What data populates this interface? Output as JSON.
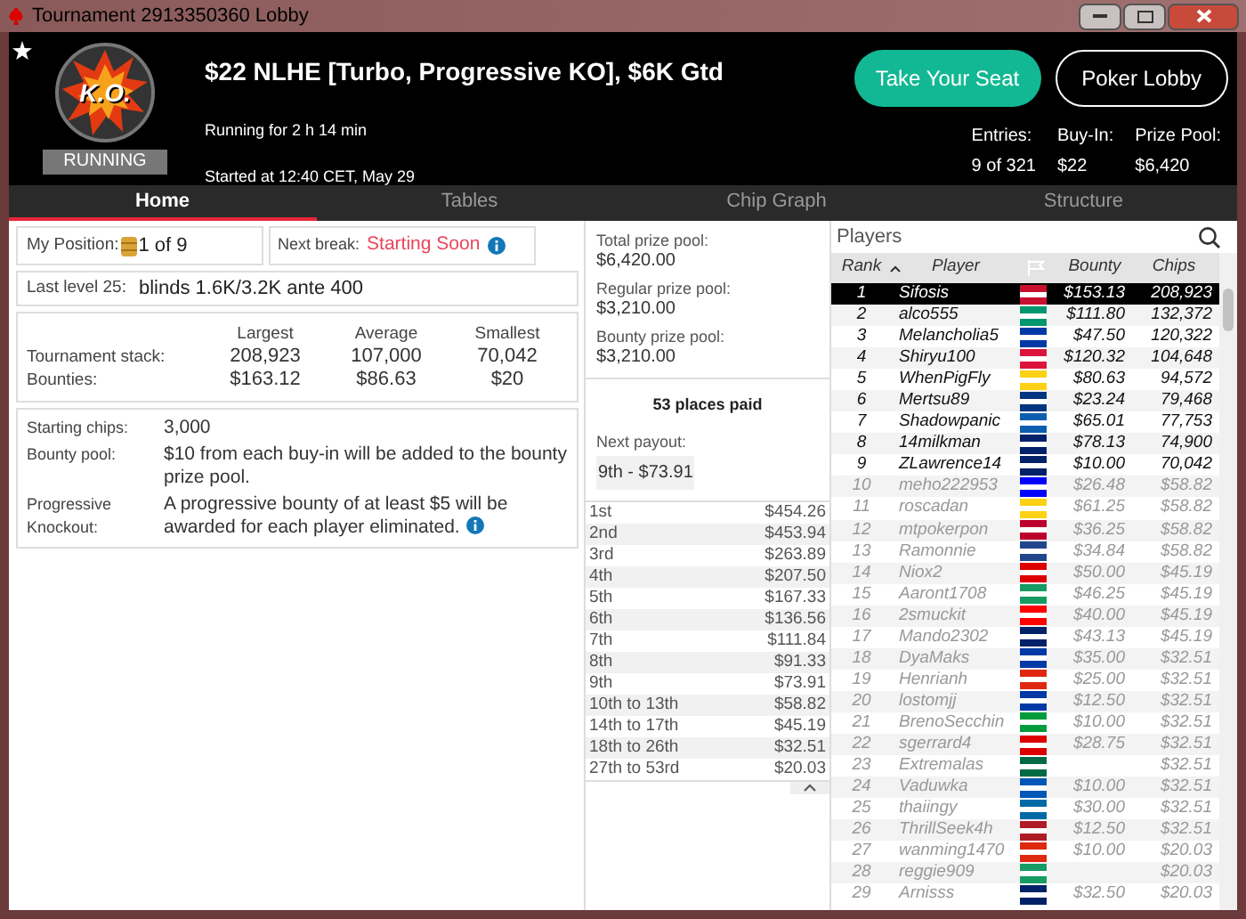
{
  "window": {
    "title": "Tournament 2913350360 Lobby"
  },
  "header": {
    "logo_text": "K.O.",
    "status": "RUNNING",
    "title": "$22 NLHE [Turbo, Progressive KO], $6K Gtd",
    "running_for": "Running for 2 h 14 min",
    "started": "Started at 12:40 CET, May 29",
    "favorite": false,
    "buttons": [
      {
        "label": "Take Your Seat",
        "kind": "primary"
      },
      {
        "label": "Poker Lobby",
        "kind": "outline"
      }
    ],
    "stats": [
      {
        "label": "Entries:",
        "value": "9 of 321"
      },
      {
        "label": "Buy-In:",
        "value": "$22"
      },
      {
        "label": "Prize Pool:",
        "value": "$6,420"
      }
    ]
  },
  "tabs": [
    {
      "label": "Home",
      "selected": true
    },
    {
      "label": "Tables",
      "selected": false
    },
    {
      "label": "Chip Graph",
      "selected": false
    },
    {
      "label": "Structure",
      "selected": false
    }
  ],
  "home": {
    "position_label": "My Position:",
    "position": "1 of 9",
    "break_label": "Next break:",
    "break_value": "Starting Soon",
    "last_level_label": "Last level 25:",
    "last_level": "blinds 1.6K/3.2K ante 400",
    "stack_table": {
      "columns": [
        "Largest",
        "Average",
        "Smallest"
      ],
      "rows": [
        {
          "label": "Tournament stack:",
          "values": [
            "208,923",
            "107,000",
            "70,042"
          ]
        },
        {
          "label": "Bounties:",
          "values": [
            "$163.12",
            "$86.63",
            "$20"
          ]
        }
      ]
    },
    "info": [
      {
        "label": "Starting chips:",
        "text": "3,000",
        "info_icon": false
      },
      {
        "label": "Bounty pool:",
        "text": "$10 from each buy-in will be added to the bounty prize pool.",
        "info_icon": false
      },
      {
        "label": "Progressive Knockout:",
        "text": "A progressive bounty of at least $5 will be awarded for each player eliminated.",
        "info_icon": true
      }
    ]
  },
  "prizes": {
    "pools": [
      {
        "label": "Total prize pool:",
        "value": "$6,420.00"
      },
      {
        "label": "Regular prize pool:",
        "value": "$3,210.00"
      },
      {
        "label": "Bounty prize pool:",
        "value": "$3,210.00"
      }
    ],
    "places_paid": "53 places paid",
    "next_payout_label": "Next payout:",
    "next_payout": "9th - $73.91",
    "payouts": [
      [
        "1st",
        "$454.26"
      ],
      [
        "2nd",
        "$453.94"
      ],
      [
        "3rd",
        "$263.89"
      ],
      [
        "4th",
        "$207.50"
      ],
      [
        "5th",
        "$167.33"
      ],
      [
        "6th",
        "$136.56"
      ],
      [
        "7th",
        "$111.84"
      ],
      [
        "8th",
        "$91.33"
      ],
      [
        "9th",
        "$73.91"
      ],
      [
        "10th to 13th",
        "$58.82"
      ],
      [
        "14th to 17th",
        "$45.19"
      ],
      [
        "18th to 26th",
        "$32.51"
      ],
      [
        "27th to 53rd",
        "$20.03"
      ]
    ]
  },
  "players": {
    "title": "Players",
    "columns": [
      "Rank",
      "Player",
      "Bounty",
      "Chips"
    ],
    "rows": [
      {
        "rank": "1",
        "name": "Sifosis",
        "bounty": "$153.13",
        "chips": "208,923",
        "selected": true,
        "greyed": false,
        "color": "#c8102e"
      },
      {
        "rank": "2",
        "name": "alco555",
        "bounty": "$111.80",
        "chips": "132,372",
        "selected": false,
        "greyed": false,
        "color": "#00966e"
      },
      {
        "rank": "3",
        "name": "Melancholia5",
        "bounty": "$47.50",
        "chips": "120,322",
        "selected": false,
        "greyed": false,
        "color": "#0039a6"
      },
      {
        "rank": "4",
        "name": "Shiryu100",
        "bounty": "$120.32",
        "chips": "104,648",
        "selected": false,
        "greyed": false,
        "color": "#dc143c"
      },
      {
        "rank": "5",
        "name": "WhenPigFly",
        "bounty": "$80.63",
        "chips": "94,572",
        "selected": false,
        "greyed": false,
        "color": "#fcd116"
      },
      {
        "rank": "6",
        "name": "Mertsu89",
        "bounty": "$23.24",
        "chips": "79,468",
        "selected": false,
        "greyed": false,
        "color": "#003580"
      },
      {
        "rank": "7",
        "name": "Shadowpanic",
        "bounty": "$65.01",
        "chips": "77,753",
        "selected": false,
        "greyed": false,
        "color": "#0d5eaf"
      },
      {
        "rank": "8",
        "name": "14milkman",
        "bounty": "$78.13",
        "chips": "74,900",
        "selected": false,
        "greyed": false,
        "color": "#012169"
      },
      {
        "rank": "9",
        "name": "ZLawrence14",
        "bounty": "$10.00",
        "chips": "70,042",
        "selected": false,
        "greyed": false,
        "color": "#012169"
      },
      {
        "rank": "10",
        "name": "meho222953",
        "bounty": "$26.48",
        "chips": "$58.82",
        "selected": false,
        "greyed": true,
        "color": "#0000ff"
      },
      {
        "rank": "11",
        "name": "roscadan",
        "bounty": "$61.25",
        "chips": "$58.82",
        "selected": false,
        "greyed": true,
        "color": "#fcd116"
      },
      {
        "rank": "12",
        "name": "mtpokerpon",
        "bounty": "$36.25",
        "chips": "$58.82",
        "selected": false,
        "greyed": true,
        "color": "#bc002d"
      },
      {
        "rank": "13",
        "name": "Ramonnie",
        "bounty": "$34.84",
        "chips": "$58.82",
        "selected": false,
        "greyed": true,
        "color": "#21468b"
      },
      {
        "rank": "14",
        "name": "Niox2",
        "bounty": "$50.00",
        "chips": "$45.19",
        "selected": false,
        "greyed": true,
        "color": "#dd0000"
      },
      {
        "rank": "15",
        "name": "Aaront1708",
        "bounty": "$46.25",
        "chips": "$45.19",
        "selected": false,
        "greyed": true,
        "color": "#169b62"
      },
      {
        "rank": "16",
        "name": "2smuckit",
        "bounty": "$40.00",
        "chips": "$45.19",
        "selected": false,
        "greyed": true,
        "color": "#ff0000"
      },
      {
        "rank": "17",
        "name": "Mando2302",
        "bounty": "$43.13",
        "chips": "$45.19",
        "selected": false,
        "greyed": true,
        "color": "#012169"
      },
      {
        "rank": "18",
        "name": "DyaMaks",
        "bounty": "$35.00",
        "chips": "$32.51",
        "selected": false,
        "greyed": true,
        "color": "#0039a6"
      },
      {
        "rank": "19",
        "name": "Henrianh",
        "bounty": "$25.00",
        "chips": "$32.51",
        "selected": false,
        "greyed": true,
        "color": "#de2910"
      },
      {
        "rank": "20",
        "name": "lostomjj",
        "bounty": "$12.50",
        "chips": "$32.51",
        "selected": false,
        "greyed": true,
        "color": "#0039a6"
      },
      {
        "rank": "21",
        "name": "BrenoSecchin",
        "bounty": "$10.00",
        "chips": "$32.51",
        "selected": false,
        "greyed": true,
        "color": "#009c3b"
      },
      {
        "rank": "22",
        "name": "sgerrard4",
        "bounty": "$28.75",
        "chips": "$32.51",
        "selected": false,
        "greyed": true,
        "color": "#dd0000"
      },
      {
        "rank": "23",
        "name": "Extremalas",
        "bounty": "",
        "chips": "$32.51",
        "selected": false,
        "greyed": true,
        "color": "#006a44"
      },
      {
        "rank": "24",
        "name": "Vaduwka",
        "bounty": "$10.00",
        "chips": "$32.51",
        "selected": false,
        "greyed": true,
        "color": "#0057b7"
      },
      {
        "rank": "25",
        "name": "thaiingy",
        "bounty": "$30.00",
        "chips": "$32.51",
        "selected": false,
        "greyed": true,
        "color": "#006aa7"
      },
      {
        "rank": "26",
        "name": "ThrillSeek4h",
        "bounty": "$12.50",
        "chips": "$32.51",
        "selected": false,
        "greyed": true,
        "color": "#ae1c28"
      },
      {
        "rank": "27",
        "name": "wanming1470",
        "bounty": "$10.00",
        "chips": "$20.03",
        "selected": false,
        "greyed": true,
        "color": "#de2910"
      },
      {
        "rank": "28",
        "name": "reggie909",
        "bounty": "",
        "chips": "$20.03",
        "selected": false,
        "greyed": true,
        "color": "#169b62"
      },
      {
        "rank": "29",
        "name": "Arnisss",
        "bounty": "$32.50",
        "chips": "$20.03",
        "selected": false,
        "greyed": true,
        "color": "#012169"
      }
    ]
  }
}
